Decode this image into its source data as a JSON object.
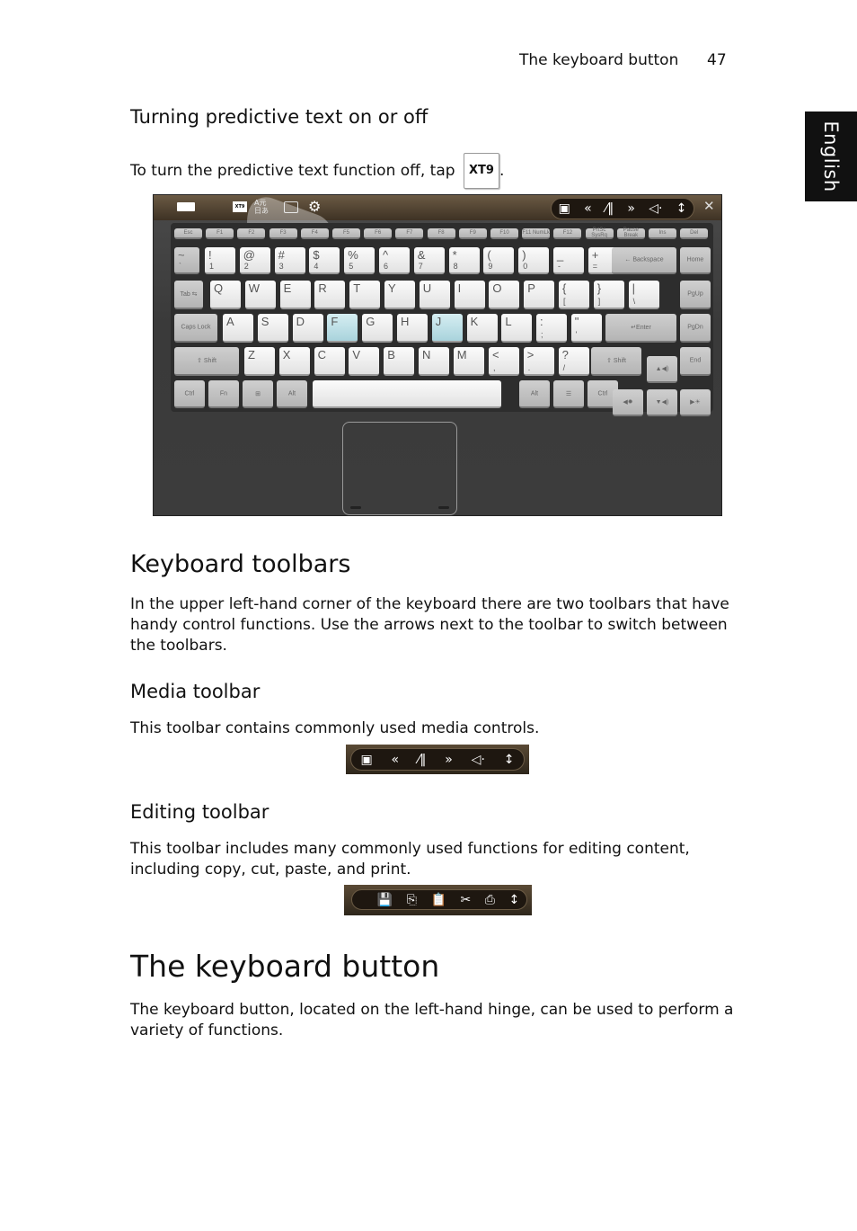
{
  "header": {
    "section_title": "The keyboard button",
    "page_number": "47"
  },
  "language_tab": "English",
  "sections": {
    "predictive": {
      "heading": "Turning predictive text on or off",
      "text_before": "To turn the predictive text function off, tap",
      "icon_label": "XT9",
      "text_after": "."
    },
    "toolbars": {
      "heading": "Keyboard toolbars",
      "body": "In the upper left-hand corner of the keyboard there are two toolbars that have handy control functions. Use the arrows next to the toolbar to switch between the toolbars."
    },
    "media": {
      "heading": "Media toolbar",
      "body": "This toolbar contains commonly used media controls."
    },
    "editing": {
      "heading": "Editing toolbar",
      "body": "This toolbar includes many commonly used functions for editing content, including copy, cut, paste, and print."
    },
    "keyboard_button": {
      "heading": "The keyboard button",
      "body": "The keyboard button, located on the left-hand hinge, can be used to perform a variety of functions."
    }
  },
  "keyboard": {
    "top_bar": {
      "xt9": "XT9",
      "lang": "A元 日あ",
      "icons": [
        "keyboard-icon",
        "xt9-icon",
        "language-icon",
        "touchpad-icon",
        "settings-icon"
      ],
      "close": "✕"
    },
    "media_icons": [
      "▣",
      "«",
      "⁄‖",
      "»",
      "◁·",
      "↕"
    ],
    "fn_row": [
      "Esc",
      "F1",
      "F2",
      "F3",
      "F4",
      "F5",
      "F6",
      "F7",
      "F8",
      "F9",
      "F10",
      "F11 NumLk",
      "F12",
      "PrtSc SysRq",
      "Pause Break",
      "Ins",
      "Del"
    ],
    "num_row": [
      [
        "~",
        "`"
      ],
      [
        "!",
        "1"
      ],
      [
        "@",
        "2"
      ],
      [
        "#",
        "3"
      ],
      [
        "$",
        "4"
      ],
      [
        "%",
        "5"
      ],
      [
        "^",
        "6"
      ],
      [
        "&",
        "7"
      ],
      [
        "*",
        "8"
      ],
      [
        "(",
        "9"
      ],
      [
        ")",
        "0"
      ],
      [
        "_",
        "-"
      ],
      [
        "+",
        "="
      ]
    ],
    "backspace": "←  Backspace",
    "home": "Home",
    "q_row": [
      "Q",
      "W",
      "E",
      "R",
      "T",
      "Y",
      "U",
      "I",
      "O",
      "P"
    ],
    "q_extra": [
      [
        "{",
        "["
      ],
      [
        "}",
        "]"
      ],
      [
        "|",
        "\\"
      ]
    ],
    "tab": "Tab ⇆",
    "pgup": "PgUp",
    "a_row": [
      "A",
      "S",
      "D",
      "F",
      "G",
      "H",
      "J",
      "K",
      "L"
    ],
    "a_extra": [
      [
        ":",
        ";"
      ],
      [
        "\"",
        "'"
      ]
    ],
    "caps": "Caps Lock",
    "enter": "↵Enter",
    "pgdn": "PgDn",
    "z_row": [
      "Z",
      "X",
      "C",
      "V",
      "B",
      "N",
      "M"
    ],
    "z_extra": [
      [
        "<",
        ","
      ],
      [
        ">",
        "."
      ],
      [
        "?",
        "/"
      ]
    ],
    "shift": "⇧ Shift",
    "end": "End",
    "bottom": [
      "Ctrl",
      "Fn",
      "⊞",
      "Alt",
      "Alt",
      "☰",
      "Ctrl"
    ],
    "arrows": [
      "▲◀)",
      "◀✹",
      "▼◀)",
      "▶☀"
    ]
  },
  "media_toolbar_icons": [
    "▣",
    "«",
    "⁄‖",
    "»",
    "◁·",
    "↕"
  ],
  "editing_toolbar_icons": [
    "💾",
    "⎘",
    "📋",
    "✂",
    "⎙",
    "↕"
  ]
}
